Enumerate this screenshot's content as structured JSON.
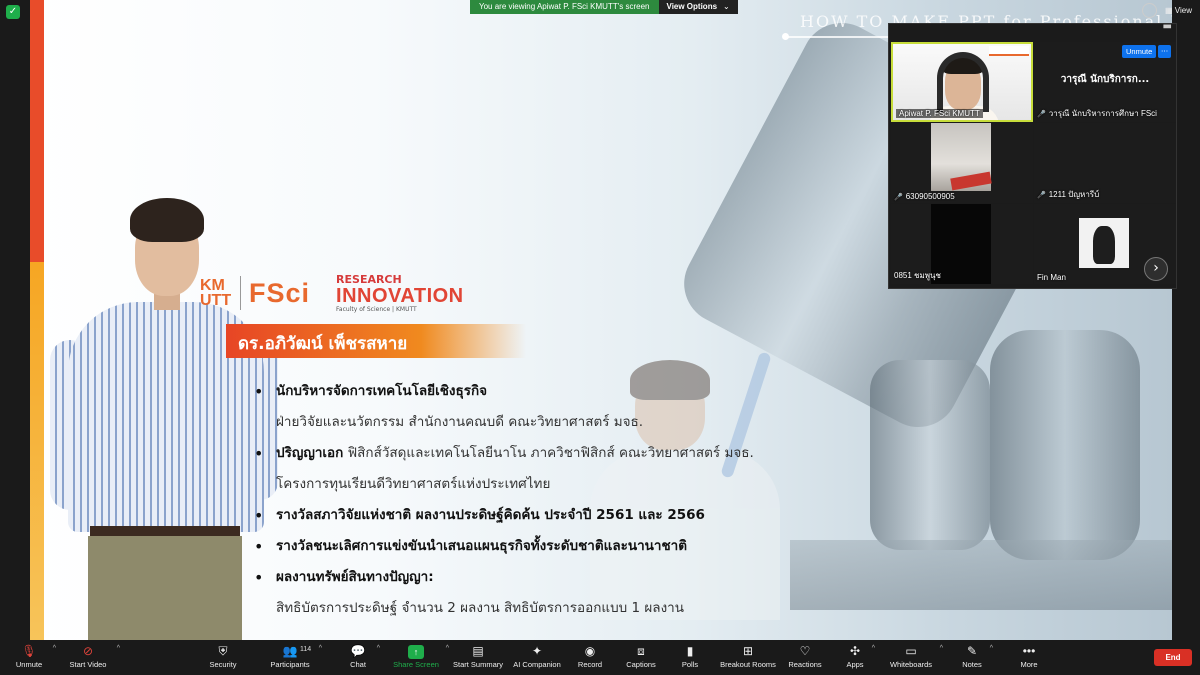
{
  "top_bar": {
    "viewing_text": "You are viewing Apiwat P. FSci KMUTT's screen",
    "view_options_label": "View Options",
    "view_label": "View"
  },
  "slide": {
    "title": "HOW TO MAKE PPT for Professional Presentation",
    "logos": {
      "kmutt": "KM UTT",
      "fsci": "FSci",
      "research": "RESEARCH",
      "innovation": "INNOVATION",
      "sub": "Faculty of Science | KMUTT"
    },
    "name": "ดร.อภิวัฒน์ เพ็ชรสหาย",
    "bullets": [
      {
        "bold": "นักบริหารจัดการเทคโนโลยีเชิงธุรกิจ",
        "text": ""
      },
      {
        "bold": "",
        "text": "ฝ่ายวิจัยและนวัตกรรม สำนักงานคณบดี คณะวิทยาศาสตร์ มจธ."
      },
      {
        "bold": "ปริญญาเอก",
        "text": " ฟิสิกส์วัสดุและเทคโนโลยีนาโน ภาควิชาฟิสิกส์ คณะวิทยาศาสตร์ มจธ."
      },
      {
        "bold": "",
        "text": "โครงการทุนเรียนดีวิทยาศาสตร์แห่งประเทศไทย"
      },
      {
        "bold": "รางวัลสภาวิจัยแห่งชาติ ผลงานประดิษฐ์คิดค้น ประจำปี 2561 และ 2566",
        "text": ""
      },
      {
        "bold": "รางวัลชนะเลิศการแข่งขันนำเสนอแผนธุรกิจทั้งระดับชาติและนานาชาติ",
        "text": ""
      },
      {
        "bold": "ผลงานทรัพย์สินทางปัญญา:",
        "text": ""
      },
      {
        "bold": "",
        "text": "สิทธิบัตรการประดิษฐ์ จำนวน 2 ผลงาน สิทธิบัตรการออกแบบ 1 ผลงาน"
      }
    ]
  },
  "gallery": {
    "tiles": [
      {
        "name": "Apiwat P. FSci KMUTT"
      },
      {
        "name": "วารุณี นักบริหารการศึกษา FSci",
        "display_name": "วารุณี นักบริการก..."
      },
      {
        "name": "63090500905"
      },
      {
        "name": "1211 ปัญหารีบ์"
      },
      {
        "name": "0851 ชมพูนุช"
      },
      {
        "name": "Fin Man"
      }
    ],
    "unmute_label": "Unmute",
    "more_label": "···"
  },
  "toolbar": {
    "unmute": "Unmute",
    "start_video": "Start Video",
    "security": "Security",
    "participants": "Participants",
    "participant_count": "114",
    "chat": "Chat",
    "share_screen": "Share Screen",
    "start_summary": "Start Summary",
    "ai_companion": "AI Companion",
    "record": "Record",
    "captions": "Captions",
    "polls": "Polls",
    "breakout_rooms": "Breakout Rooms",
    "reactions": "Reactions",
    "apps": "Apps",
    "whiteboards": "Whiteboards",
    "notes": "Notes",
    "more": "More",
    "end": "End"
  },
  "colors": {
    "accent_orange": "#e8692e",
    "strip_red": "#e84c2a",
    "strip_yellow": "#f6a623",
    "zoom_green": "#1fae4b",
    "zoom_blue": "#0e72ed",
    "end_red": "#d93025"
  }
}
